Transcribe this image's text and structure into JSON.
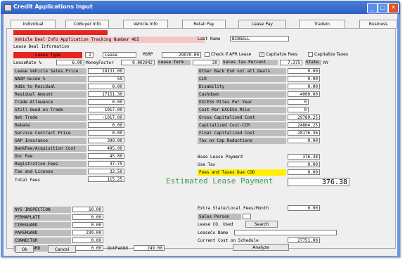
{
  "window": {
    "title": "Credit Applications Input"
  },
  "tabs": [
    "Individual",
    "CoBuyer Info",
    "Vehicle Info",
    "Retail Pay",
    "Lease Pay",
    "Tradein",
    "Business"
  ],
  "top": {
    "deal_info": "Vehicle Deal Info Application Tracking Number 465",
    "lease_deal_info": "Lease Deal Information",
    "last_name_label": "Last Name",
    "last_name": "BINGELL",
    "lease_type_label": "Lease Type",
    "lease_type_count": "2",
    "lease_type_value": "Lease",
    "msrp_label": "MSRP",
    "msrp": "29070.00",
    "check_apr_label": "Check if APR Lease",
    "capitalize_fees_label": "Capitalize Fees",
    "capitalize_taxes_label": "Capitalize Taxes",
    "lease_rate_label": "LeaseRate %",
    "lease_rate": "6.90",
    "money_factor_label": "MoneyFactor",
    "money_factor": "0.002042",
    "lease_term_label": "Lease Term",
    "lease_term": "39",
    "sales_tax_label": "Sales Tax Percent",
    "sales_tax": "7.375",
    "state_label": "State",
    "state": "NY"
  },
  "left": [
    {
      "label": "Lease Vehicle Sales Price",
      "value": "28131.00"
    },
    {
      "label": "NADP Guide %",
      "value": "59"
    },
    {
      "label": "Adds to Residual",
      "value": "0.00"
    },
    {
      "label": "Residual Amount",
      "value": "17151.30"
    },
    {
      "label": "Trade Allowance",
      "value": "0.00"
    },
    {
      "label": "Still Owed on Trade",
      "value": "1017.00"
    },
    {
      "label": "Net Trade",
      "value": "-1017.00"
    },
    {
      "label": "Rebate",
      "value": "0.00"
    },
    {
      "label": "Service Contract Price",
      "value": "0.00"
    },
    {
      "label": "GAP Insurance",
      "value": "399.00"
    },
    {
      "label": "BankFee/Acquisition Cost",
      "value": "495.00"
    },
    {
      "label": "Doc Fee",
      "value": "45.00"
    },
    {
      "label": "Registration Fees",
      "value": "37.75"
    },
    {
      "label": "Tax and License",
      "value": "32.50"
    },
    {
      "label": "Total Fees",
      "value": "115.25"
    }
  ],
  "right": [
    {
      "label": "Other Back End not all Deals",
      "value": "0.00"
    },
    {
      "label": "CLR",
      "value": "0.00"
    },
    {
      "label": "Disability",
      "value": "0.00"
    },
    {
      "label": "Cashdown",
      "value": "4000.00"
    },
    {
      "label": "EXCESS Miles Per Year",
      "value": "0"
    },
    {
      "label": "Cost Per EXCESS Mile",
      "value": "0"
    },
    {
      "label": "Gross Capitalized Cost",
      "value": "29789.25"
    },
    {
      "label": "Capitalized Cost-CCR",
      "value": "24804.25"
    },
    {
      "label": "Final Capitalized Cost",
      "value": "28176.36"
    },
    {
      "label": "Tax on Cap Reductions",
      "value": "0.00"
    }
  ],
  "payment": {
    "base_label": "Base Lease Payment",
    "base": "376.38",
    "use_tax_label": "Use Tax",
    "use_tax": "0.00",
    "fees_taxes_label": "Fees and Taxes  Due COD",
    "fees_taxes": "0.00",
    "estimated_label": "Estimated Lease Payment",
    "estimated": "376.38"
  },
  "bottom_left": [
    {
      "label": "NYS INSPECTION",
      "value": "10.00"
    },
    {
      "label": "PERMAPLATE",
      "value": "0.00"
    },
    {
      "label": "TIREGUARD",
      "value": "0.00"
    },
    {
      "label": "PAPERGARD",
      "value": "239.00"
    },
    {
      "label": "CONNECTOR",
      "value": "0.00"
    },
    {
      "label": "TRASHGUARD",
      "value": "0.00"
    }
  ],
  "dotpadd": {
    "label": "DotPaddd",
    "value": "249.00"
  },
  "bottom_right": {
    "extra_label": "Extra State/Local Fees/Month",
    "extra": "0.00",
    "sales_person_label": "Sales Person",
    "lease_co_label": "Lease CO. Used",
    "search_label": "Search",
    "leaseco_name_label": "LeaseCo Name",
    "current_cost_label": "Current Cost on Schedule",
    "current_cost": "27751.00",
    "analyze_label": "Analyze"
  },
  "buttons": {
    "ok": "Ok",
    "cancel": "Cancel"
  }
}
